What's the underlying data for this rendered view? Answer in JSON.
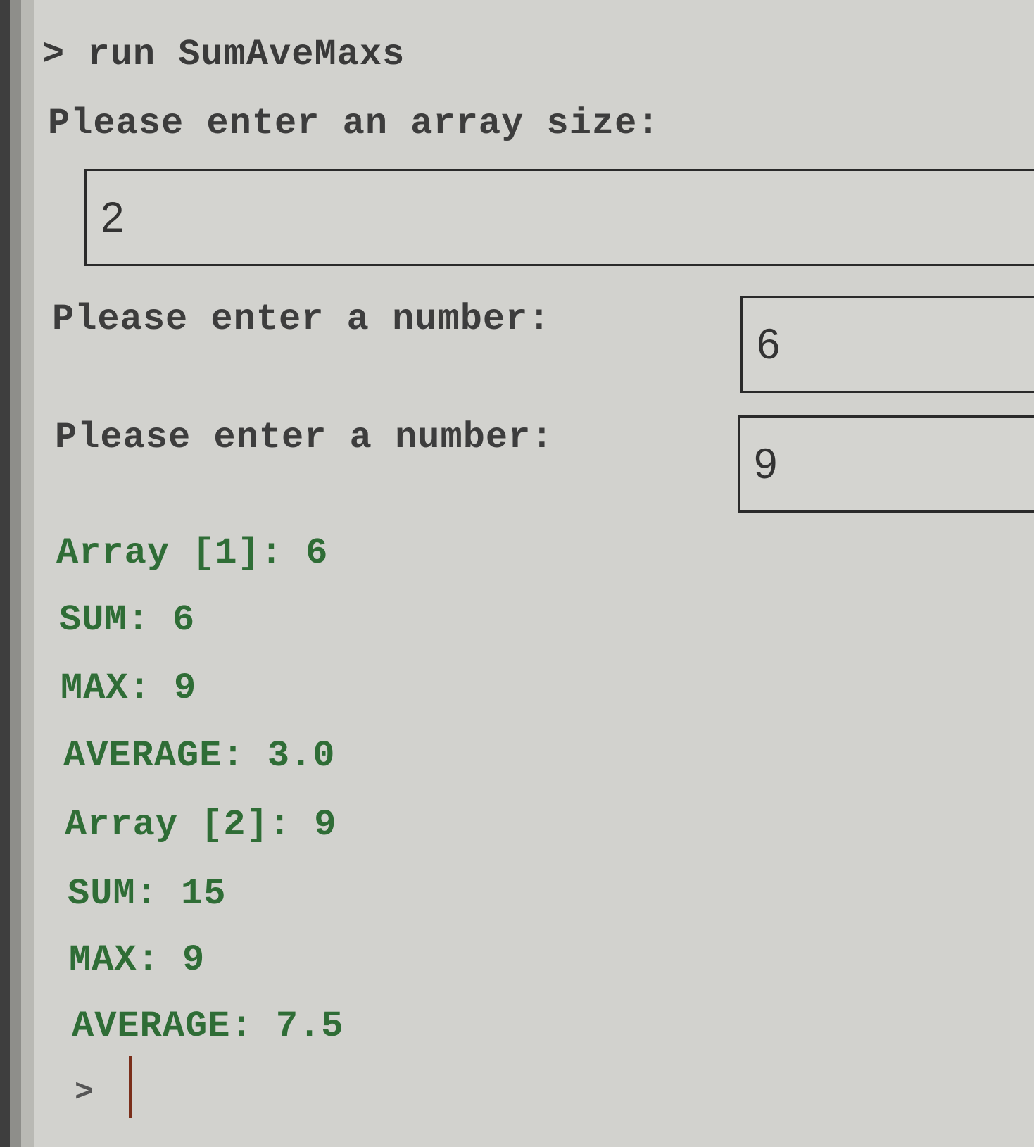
{
  "console": {
    "command_prompt": ">",
    "command": "run SumAveMaxs",
    "size_prompt": "Please enter an array size:",
    "size_input": "2",
    "number_prompts": [
      {
        "label": "Please enter a number:",
        "value": "6"
      },
      {
        "label": "Please enter a number:",
        "value": "9"
      }
    ],
    "output_lines": [
      "Array [1]: 6",
      "SUM: 6",
      "MAX: 9",
      "AVERAGE: 3.0",
      "Array [2]: 9",
      "SUM: 15",
      "MAX: 9",
      "AVERAGE: 7.5"
    ],
    "final_prompt": ">"
  }
}
